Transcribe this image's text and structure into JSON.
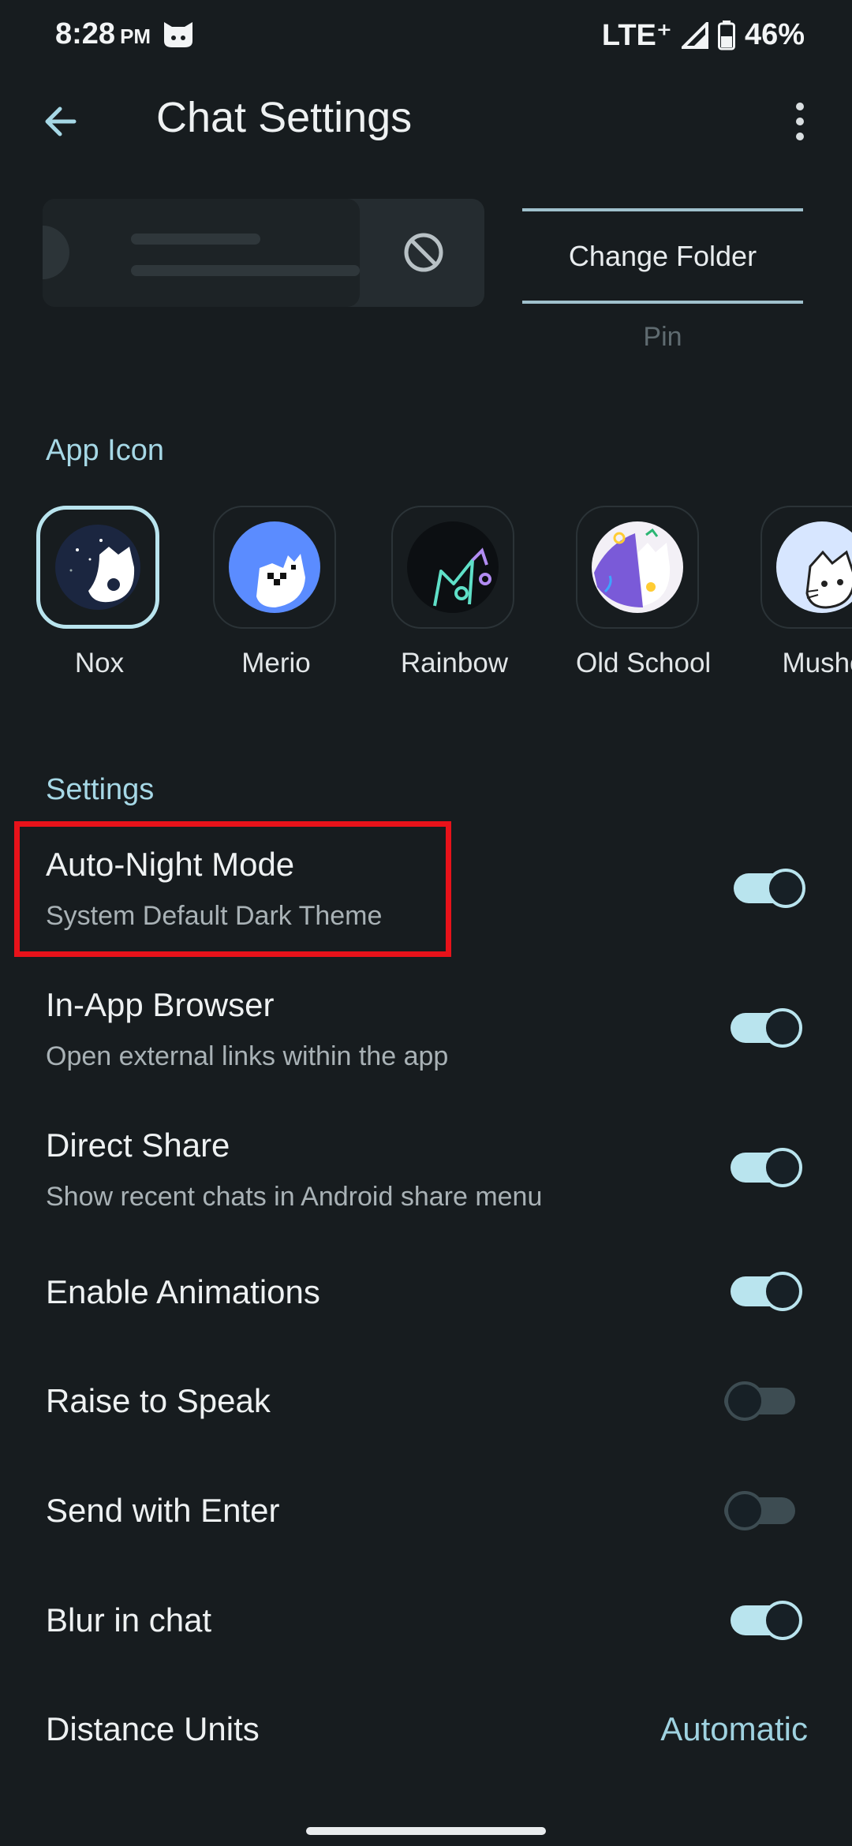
{
  "status_bar": {
    "time": "8:28",
    "ampm": "PM",
    "network": "LTE⁺",
    "battery": "46%"
  },
  "toolbar": {
    "title": "Chat Settings"
  },
  "preview": {
    "change_folder_label": "Change Folder",
    "pin_label": "Pin"
  },
  "app_icon_section": {
    "title": "App Icon",
    "icons": [
      {
        "label": "Nox",
        "selected": true
      },
      {
        "label": "Merio",
        "selected": false
      },
      {
        "label": "Rainbow",
        "selected": false
      },
      {
        "label": "Old School",
        "selected": false
      },
      {
        "label": "Mushe",
        "selected": false
      }
    ]
  },
  "settings_section": {
    "title": "Settings",
    "rows": [
      {
        "title": "Auto-Night Mode",
        "subtitle": "System Default Dark Theme",
        "enabled": true
      },
      {
        "title": "In-App Browser",
        "subtitle": "Open external links within the app",
        "enabled": true
      },
      {
        "title": "Direct Share",
        "subtitle": "Show recent chats in Android share menu",
        "enabled": true
      },
      {
        "title": "Enable Animations",
        "enabled": true
      },
      {
        "title": "Raise to Speak",
        "enabled": false
      },
      {
        "title": "Send with Enter",
        "enabled": false
      },
      {
        "title": "Blur in chat",
        "enabled": true
      }
    ],
    "distance_units": {
      "title": "Distance Units",
      "value": "Automatic"
    }
  },
  "colors": {
    "accent": "#9fd2e0",
    "background": "#171c1f",
    "toggle_on_track": "#b9e4ee",
    "toggle_off_track": "#3d4c52",
    "highlight": "#e8121a"
  },
  "icons": [
    "back-arrow-icon",
    "more-vert-icon",
    "block-icon",
    "signal-icon",
    "battery-icon",
    "cat-icon"
  ]
}
